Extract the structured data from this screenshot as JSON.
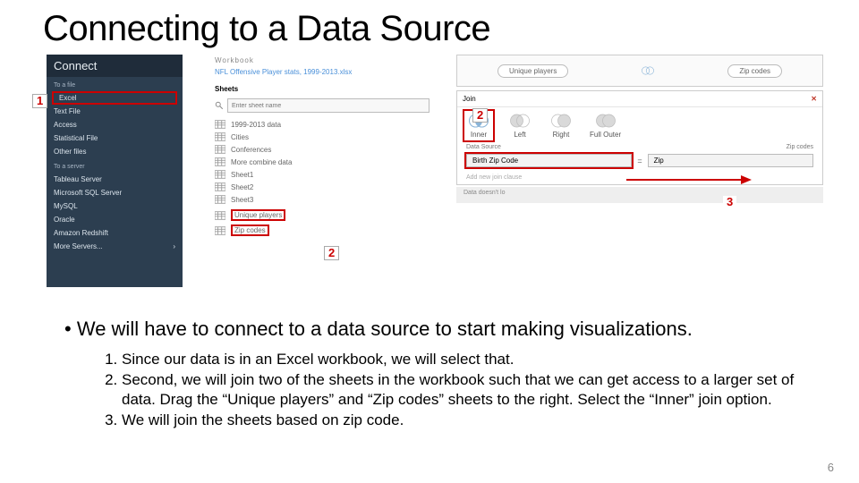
{
  "title": "Connecting to a Data Source",
  "connect_panel": {
    "header": "Connect",
    "to_file_label": "To a file",
    "file_items": [
      "Excel",
      "Text File",
      "Access",
      "Statistical File",
      "Other files"
    ],
    "to_server_label": "To a server",
    "server_items": [
      "Tableau Server",
      "Microsoft SQL Server",
      "MySQL",
      "Oracle",
      "Amazon Redshift"
    ],
    "more_label": "More Servers...",
    "chevron": "›"
  },
  "workbook": {
    "header": "Workbook",
    "file": "NFL Offensive Player stats, 1999-2013.xlsx",
    "sheets_label": "Sheets",
    "search_placeholder": "Enter sheet name",
    "sheets": [
      "1999-2013 data",
      "Cities",
      "Conferences",
      "More combine data",
      "Sheet1",
      "Sheet2",
      "Sheet3"
    ],
    "highlight_sheets": [
      "Unique players",
      "Zip codes"
    ]
  },
  "join_canvas": {
    "left_pill": "Unique players",
    "right_pill": "Zip codes"
  },
  "join_dialog": {
    "title": "Join",
    "close": "✕",
    "types": [
      "Inner",
      "Left",
      "Right",
      "Full Outer"
    ],
    "ds_left": "Data Source",
    "ds_right": "Zip codes",
    "field_left": "Birth Zip Code",
    "eq": "=",
    "field_right": "Zip",
    "add_hint": "Add new join clause",
    "grey_note": "Data doesn't lo"
  },
  "callouts": {
    "one": "1",
    "two": "2",
    "three": "3"
  },
  "body": {
    "bullet": "We will have to connect to a data source to start making visualizations.",
    "steps": [
      "Since our data is in an Excel workbook, we will select that.",
      "Second, we will join two of the sheets in the workbook such that we can get access to a larger set of data. Drag the “Unique players” and “Zip codes” sheets to the right. Select the “Inner” join option.",
      "We will join the sheets based on zip code."
    ]
  },
  "page_number": "6"
}
